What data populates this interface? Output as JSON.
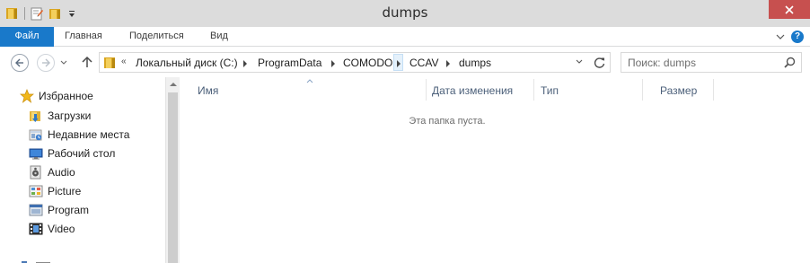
{
  "window": {
    "title": "dumps"
  },
  "ribbon": {
    "tabs": [
      {
        "label": "Файл",
        "active": true
      },
      {
        "label": "Главная"
      },
      {
        "label": "Поделиться"
      },
      {
        "label": "Вид"
      }
    ],
    "help_label": "?"
  },
  "navigation": {
    "overflow_label": "«",
    "breadcrumbs": [
      "Локальный диск (C:)",
      "ProgramData",
      "COMODO",
      "CCAV",
      "dumps"
    ],
    "search_placeholder": "Поиск: dumps"
  },
  "sidebar": {
    "favorites_label": "Избранное",
    "items": [
      {
        "label": "Загрузки",
        "icon": "downloads-icon"
      },
      {
        "label": "Недавние места",
        "icon": "recent-places-icon"
      },
      {
        "label": "Рабочий стол",
        "icon": "desktop-icon"
      },
      {
        "label": "Audio",
        "icon": "audio-folder-icon"
      },
      {
        "label": "Picture",
        "icon": "picture-folder-icon"
      },
      {
        "label": "Program",
        "icon": "program-folder-icon"
      },
      {
        "label": "Video",
        "icon": "video-folder-icon"
      }
    ]
  },
  "content": {
    "columns": [
      "Имя",
      "Дата изменения",
      "Тип",
      "Размер"
    ],
    "empty_message": "Эта папка пуста."
  },
  "colors": {
    "accent": "#1979ca",
    "close_button": "#c7504f",
    "titlebar": "#dcdcdc",
    "column_header_text": "#4c607a"
  }
}
